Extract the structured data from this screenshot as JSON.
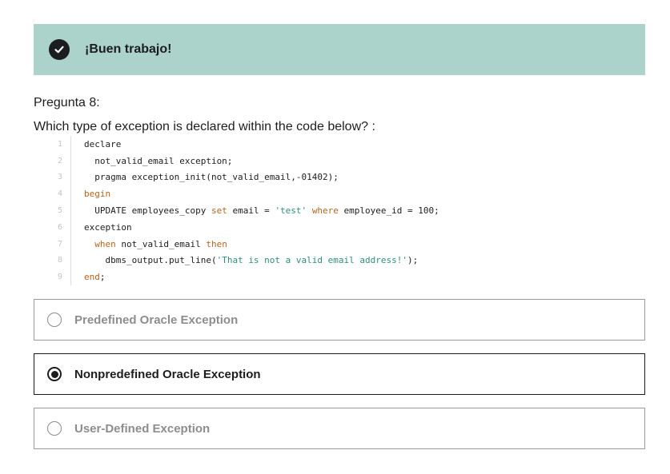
{
  "banner": {
    "message": "¡Buen trabajo!",
    "icon": "check-icon",
    "background_color": "#acd2cc"
  },
  "question": {
    "label": "Pregunta 8:",
    "text": "Which type of exception is declared within the code below? :"
  },
  "code": {
    "lines": [
      {
        "number": "1",
        "tokens": [
          {
            "t": "declare",
            "c": "plain"
          }
        ]
      },
      {
        "number": "2",
        "tokens": [
          {
            "t": "  not_valid_email exception;",
            "c": "plain"
          }
        ]
      },
      {
        "number": "3",
        "tokens": [
          {
            "t": "  pragma exception_init(not_valid_email,-01402);",
            "c": "plain"
          }
        ]
      },
      {
        "number": "4",
        "tokens": [
          {
            "t": "begin",
            "c": "kw"
          }
        ]
      },
      {
        "number": "5",
        "tokens": [
          {
            "t": "  UPDATE employees_copy ",
            "c": "plain"
          },
          {
            "t": "set",
            "c": "kw"
          },
          {
            "t": " email = ",
            "c": "plain"
          },
          {
            "t": "'test'",
            "c": "str"
          },
          {
            "t": " ",
            "c": "plain"
          },
          {
            "t": "where",
            "c": "kw"
          },
          {
            "t": " employee_id = 100;",
            "c": "plain"
          }
        ]
      },
      {
        "number": "6",
        "tokens": [
          {
            "t": "exception",
            "c": "plain"
          }
        ]
      },
      {
        "number": "7",
        "tokens": [
          {
            "t": "  ",
            "c": "plain"
          },
          {
            "t": "when",
            "c": "kw"
          },
          {
            "t": " not_valid_email ",
            "c": "plain"
          },
          {
            "t": "then",
            "c": "kw"
          }
        ]
      },
      {
        "number": "8",
        "tokens": [
          {
            "t": "    dbms_output.put_line(",
            "c": "plain"
          },
          {
            "t": "'That is not a valid email address!'",
            "c": "str"
          },
          {
            "t": ");",
            "c": "plain"
          }
        ]
      },
      {
        "number": "9",
        "tokens": [
          {
            "t": "end",
            "c": "kw"
          },
          {
            "t": ";",
            "c": "plain"
          }
        ]
      }
    ]
  },
  "options": [
    {
      "label": "Predefined Oracle Exception",
      "selected": false
    },
    {
      "label": "Nonpredefined Oracle Exception",
      "selected": true
    },
    {
      "label": "User-Defined Exception",
      "selected": false
    }
  ]
}
